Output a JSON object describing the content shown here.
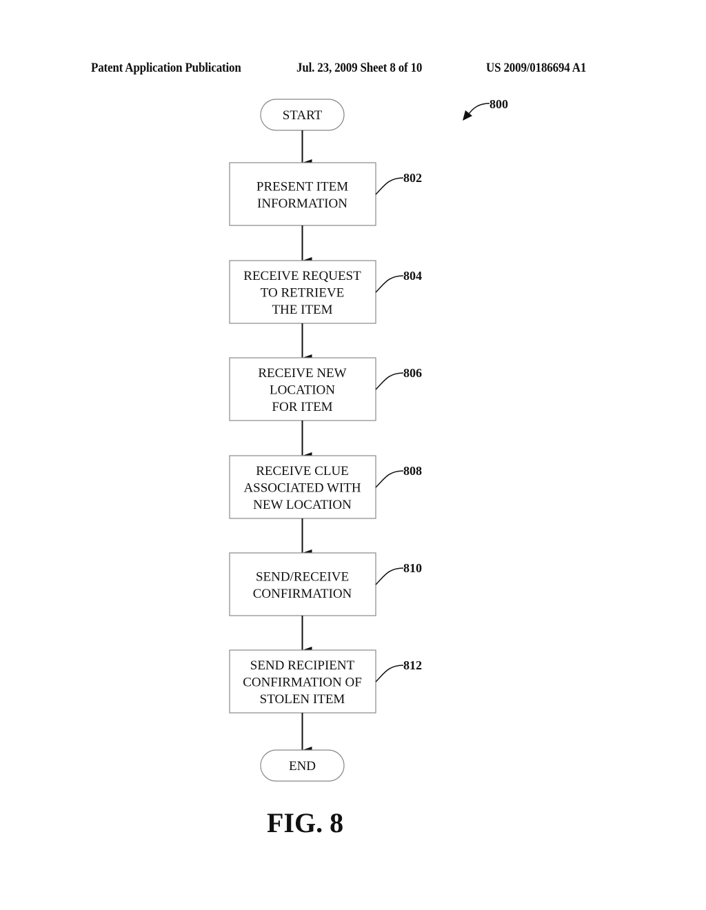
{
  "header": {
    "left": "Patent Application Publication",
    "middle": "Jul. 23, 2009   Sheet 8 of 10",
    "right": "US 2009/0186694 A1"
  },
  "diagram": {
    "figure_ref": "800",
    "start_label": "START",
    "end_label": "END",
    "steps": [
      {
        "ref": "802",
        "lines": [
          "PRESENT ITEM",
          "INFORMATION"
        ]
      },
      {
        "ref": "804",
        "lines": [
          "RECEIVE REQUEST",
          "TO RETRIEVE",
          "THE ITEM"
        ]
      },
      {
        "ref": "806",
        "lines": [
          "RECEIVE NEW",
          "LOCATION",
          "FOR ITEM"
        ]
      },
      {
        "ref": "808",
        "lines": [
          "RECEIVE CLUE",
          "ASSOCIATED WITH",
          "NEW LOCATION"
        ]
      },
      {
        "ref": "810",
        "lines": [
          "SEND/RECEIVE",
          "CONFIRMATION"
        ]
      },
      {
        "ref": "812",
        "lines": [
          "SEND RECIPIENT",
          "CONFIRMATION OF",
          "STOLEN ITEM"
        ]
      }
    ]
  },
  "figure_label": "FIG. 8"
}
